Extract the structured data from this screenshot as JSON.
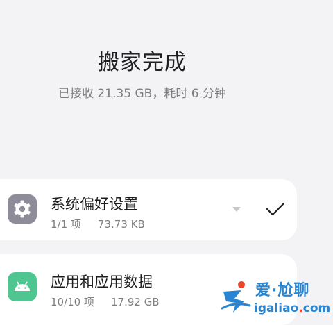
{
  "header": {
    "title": "搬家完成",
    "summary": "已接收 21.35 GB，耗时 6 分钟"
  },
  "items": [
    {
      "name": "系统偏好设置",
      "count": "1/1 项",
      "size": "73.73 KB",
      "icon": "gear-icon",
      "icon_color": "#8e8c99",
      "status": "check-icon"
    },
    {
      "name": "应用和应用数据",
      "count": "10/10 项",
      "size": "17.92 GB",
      "icon": "android-icon",
      "icon_color": "#4fc691"
    }
  ],
  "watermark": {
    "brand_cn": "爱·尬聊",
    "domain_a": "igaliao",
    "domain_dot": ".",
    "domain_b": "com",
    "color": "#2a84cf"
  }
}
